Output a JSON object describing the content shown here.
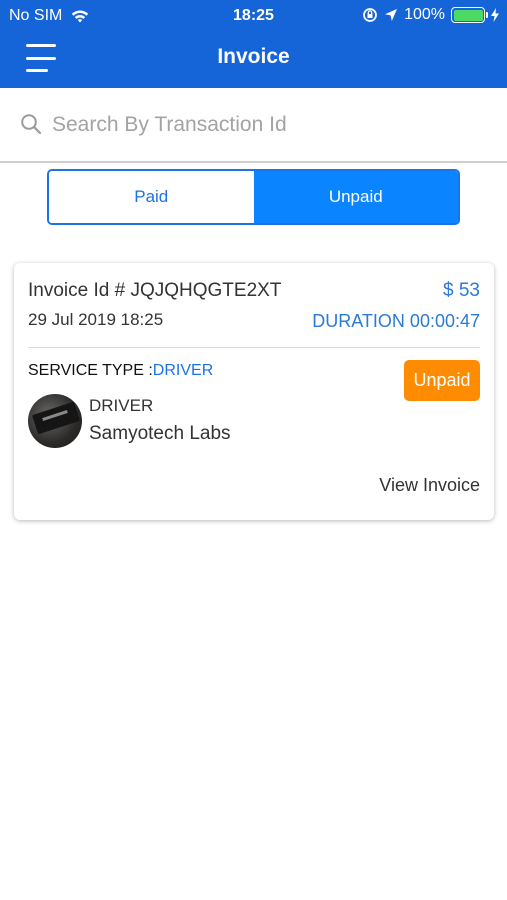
{
  "status_bar": {
    "carrier": "No SIM",
    "time": "18:25",
    "battery": "100%",
    "icons": [
      "wifi-icon",
      "lock-rotation-icon",
      "location-arrow-icon",
      "battery-icon",
      "charging-bolt-icon"
    ]
  },
  "nav": {
    "title": "Invoice",
    "menu_icon": "hamburger-menu-icon"
  },
  "search": {
    "placeholder": "Search By Transaction Id",
    "value": "",
    "icon": "search-icon"
  },
  "tabs": [
    {
      "label": "Paid",
      "selected": false
    },
    {
      "label": "Unpaid",
      "selected": true
    }
  ],
  "invoice": {
    "id_text": "Invoice Id # JQJQHQGTE2XT",
    "amount": "$ 53",
    "date": "29 Jul 2019 18:25",
    "duration": "DURATION 00:00:47",
    "service_label": "SERVICE TYPE :",
    "service_value": "DRIVER",
    "status": "Unpaid",
    "driver_role": "DRIVER",
    "driver_name": "Samyotech Labs",
    "view_label": "View Invoice"
  },
  "colors": {
    "header_bg": "#1565d8",
    "accent_blue": "#1a73e8",
    "unpaid_badge": "#ff8c00",
    "battery_green": "#4cd964"
  }
}
